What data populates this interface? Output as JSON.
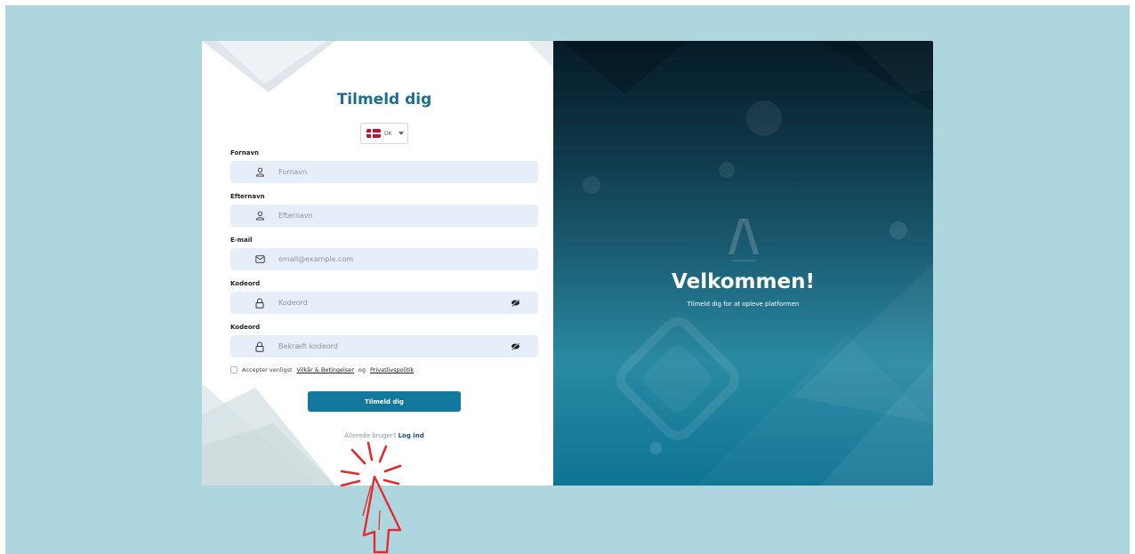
{
  "form": {
    "title": "Tilmeld dig",
    "language": {
      "code": "DK"
    },
    "fields": [
      {
        "label": "Fornavn",
        "placeholder": "Fornavn",
        "icon": "user-icon"
      },
      {
        "label": "Efternavn",
        "placeholder": "Efternavn",
        "icon": "user-icon"
      },
      {
        "label": "E-mail",
        "placeholder": "email@example.com",
        "icon": "mail-icon"
      },
      {
        "label": "Kodeord",
        "placeholder": "Kodeord",
        "icon": "lock-icon"
      },
      {
        "label": "Kodeord",
        "placeholder": "Bekræft kodeord",
        "icon": "lock-icon"
      }
    ],
    "terms": {
      "prefix": "Accepter venligst",
      "link1": "Vilkår & Betingelser",
      "middle": "og",
      "link2": "Privatlivspolitik"
    },
    "submit_label": "Tilmeld dig",
    "login": {
      "prefix": "Allerede bruger?",
      "link": "Log ind"
    }
  },
  "welcome": {
    "heading": "Velkommen!",
    "subtitle": "Tilmeld dig for at opleve platformen"
  },
  "colors": {
    "accent": "#13789d",
    "title": "#1d6f92",
    "backdrop": "#aed6df",
    "field_bg": "#e5eef9",
    "annotation": "#e32b2b"
  }
}
